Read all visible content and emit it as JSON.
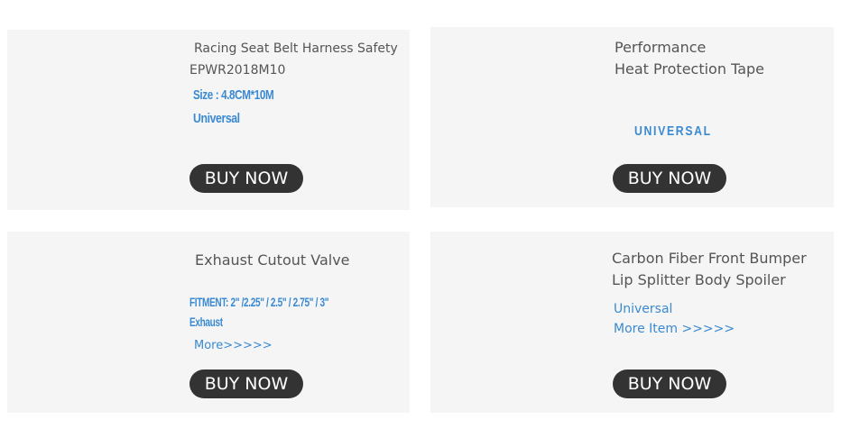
{
  "products": [
    {
      "title_line1": "Racing Seat Belt Harness Safety",
      "title_line2": "EPWR2018M10",
      "spec": "Size : 4.8CM*10M",
      "fitment": "Universal",
      "button": "BUY NOW"
    },
    {
      "title_line1": "Performance",
      "title_line2": "Heat Protection Tape",
      "fitment": "UNIVERSAL",
      "button": "BUY NOW"
    },
    {
      "title_line1": "Exhaust Cutout Valve",
      "spec_line1": "FITMENT: 2\" /2.25\" / 2.5\" / 2.75\" / 3\"",
      "spec_line2": "Exhaust",
      "more": "More>>>>>",
      "button": "BUY NOW"
    },
    {
      "title_line1": "Carbon Fiber Front Bumper",
      "title_line2": "Lip Splitter Body Spoiler",
      "fitment": "Universal",
      "more": "More  Item >>>>>",
      "button": "BUY NOW"
    }
  ],
  "colors": {
    "accent": "#3a8ad1",
    "button_bg": "#333333",
    "card_bg": "#f5f5f5",
    "text": "#555555"
  }
}
